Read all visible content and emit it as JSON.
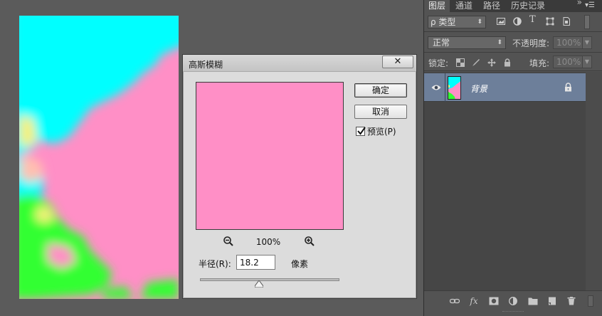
{
  "colors": {
    "canvas_pink": "#ff8fc6",
    "canvas_cyan": "#00ffff",
    "canvas_green": "#33ff33",
    "canvas_yellow": "#f5f07a",
    "layer_selected": "#6d7f9a",
    "app_background": "#5b5b5b"
  },
  "dialog": {
    "title": "高斯模糊",
    "close_label": "✕",
    "ok_label": "确定",
    "cancel_label": "取消",
    "preview_label": "预览(P)",
    "preview_checked": true,
    "zoom_level": "100%",
    "radius_label": "半径(R):",
    "radius_value": "18.2",
    "radius_unit": "像素",
    "zoom_out_icon": "zoom-out-icon",
    "zoom_in_icon": "zoom-in-icon"
  },
  "layers_panel": {
    "tabs": [
      {
        "label": "图层"
      },
      {
        "label": "通道"
      },
      {
        "label": "路径"
      },
      {
        "label": "历史记录"
      }
    ],
    "filter": {
      "label": "ρ 类型"
    },
    "blend_mode": "正常",
    "opacity_label": "不透明度:",
    "opacity_value": "100%",
    "lock_label": "锁定:",
    "fill_label": "填充:",
    "fill_value": "100%",
    "layers": [
      {
        "name": "背景",
        "visible": true,
        "locked": true
      }
    ],
    "bottom_icons": [
      "link-layers-icon",
      "fx-icon",
      "add-mask-icon",
      "adjustment-layer-icon",
      "new-group-icon",
      "new-layer-icon",
      "delete-layer-icon"
    ],
    "fx_label": "fx"
  }
}
